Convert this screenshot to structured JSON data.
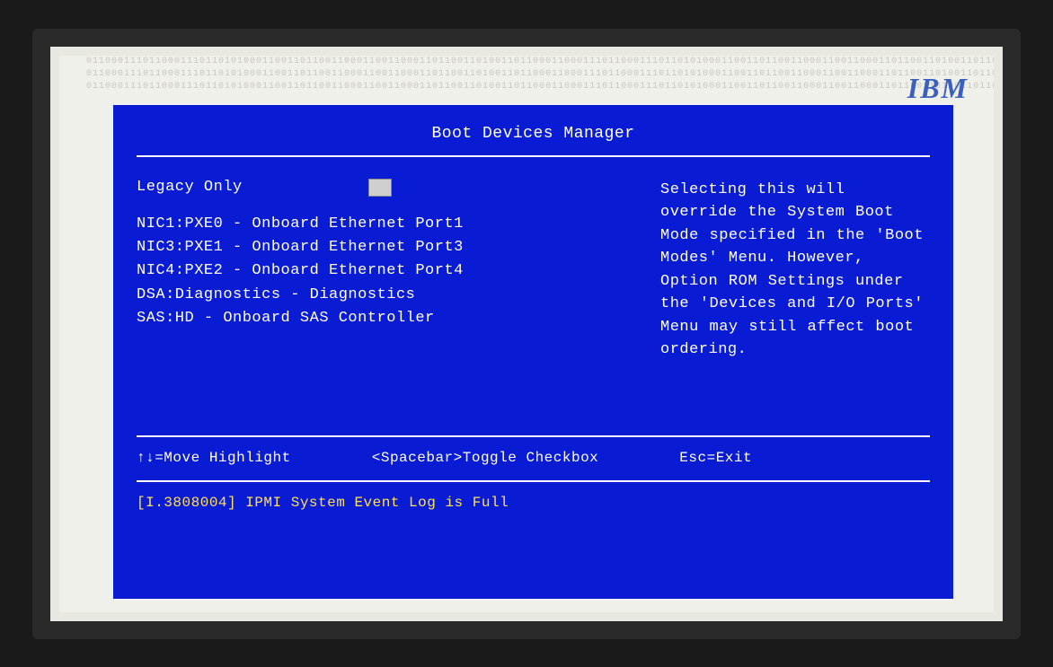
{
  "logo": "IBM",
  "title": "Boot Devices Manager",
  "legacy": {
    "label": "Legacy Only",
    "checked": false
  },
  "boot_items": [
    "NIC1:PXE0 - Onboard Ethernet Port1",
    "NIC3:PXE1 - Onboard Ethernet Port3",
    "NIC4:PXE2 - Onboard Ethernet Port4",
    "DSA:Diagnostics - Diagnostics",
    "SAS:HD - Onboard SAS Controller"
  ],
  "help_text": "Selecting this will override the System Boot Mode specified in the 'Boot Modes' Menu. However, Option ROM Settings under the 'Devices and I/O Ports' Menu may still affect boot ordering.",
  "hints": {
    "move": "↑↓=Move Highlight",
    "toggle": "<Spacebar>Toggle Checkbox",
    "exit": "Esc=Exit"
  },
  "status": "[I.3808004] IPMI System Event Log is Full",
  "deco_binary": "0110001110110001110110101000110011011001100011001100011011001101001101100"
}
